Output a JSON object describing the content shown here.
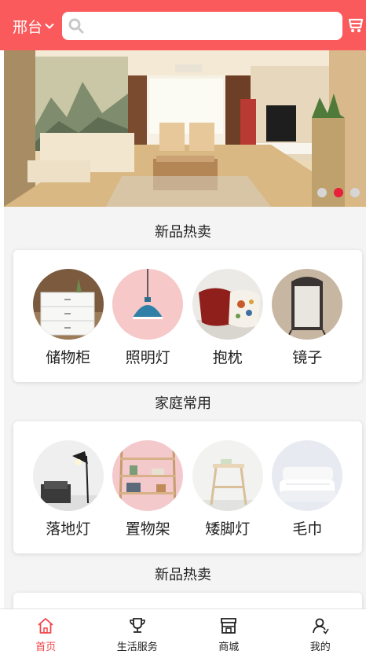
{
  "header": {
    "city": "邢台",
    "search_placeholder": "",
    "cart_icon": "cart-icon",
    "colors": {
      "primary": "#fb5a5c",
      "active": "#f0464a",
      "dot_active": "#e8203a"
    }
  },
  "banner": {
    "slides": 3,
    "active_index": 1
  },
  "sections": [
    {
      "title": "新品热卖",
      "items": [
        {
          "label": "储物柜",
          "icon": "cabinet-image"
        },
        {
          "label": "照明灯",
          "icon": "pendant-lamp-image"
        },
        {
          "label": "抱枕",
          "icon": "pillow-image"
        },
        {
          "label": "镜子",
          "icon": "mirror-image"
        }
      ]
    },
    {
      "title": "家庭常用",
      "items": [
        {
          "label": "落地灯",
          "icon": "floor-lamp-image"
        },
        {
          "label": "置物架",
          "icon": "shelf-image"
        },
        {
          "label": "矮脚灯",
          "icon": "stool-image"
        },
        {
          "label": "毛巾",
          "icon": "towel-image"
        }
      ]
    },
    {
      "title": "新品热卖"
    }
  ],
  "tabbar": [
    {
      "label": "首页",
      "icon": "home-icon",
      "active": true
    },
    {
      "label": "生活服务",
      "icon": "trophy-icon",
      "active": false
    },
    {
      "label": "商城",
      "icon": "store-icon",
      "active": false
    },
    {
      "label": "我的",
      "icon": "user-icon",
      "active": false
    }
  ]
}
